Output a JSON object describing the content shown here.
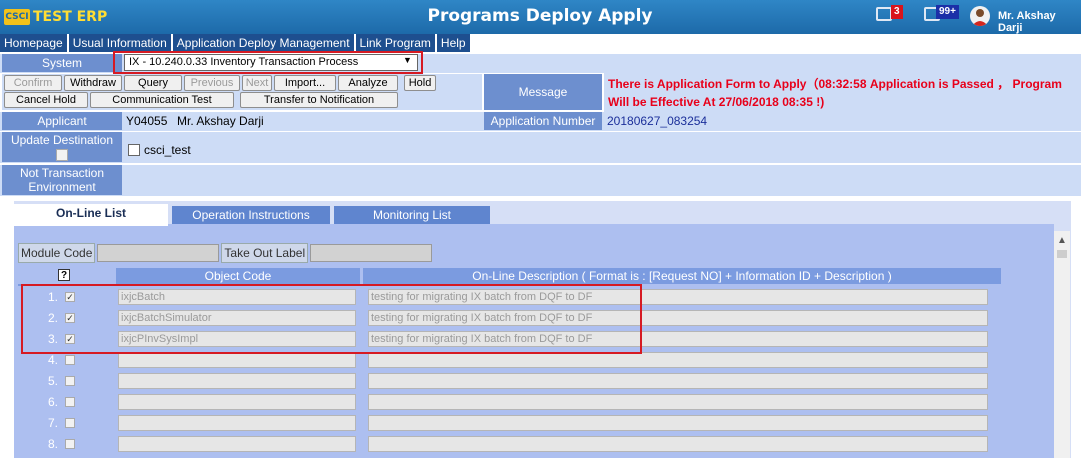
{
  "app": {
    "logo_mark": "CSCI",
    "logo_text": "TEST ERP",
    "page_title": "Programs Deploy Apply"
  },
  "header": {
    "notification_count": "3",
    "mail_count": "99+",
    "user_name": "Mr. Akshay Darji"
  },
  "menu": [
    "Homepage",
    "Usual Information",
    "Application Deploy Management",
    "Link Program",
    "Help"
  ],
  "form": {
    "system_label": "System",
    "system_value": "IX - 10.240.0.33 Inventory Transaction Process",
    "buttons_row1": [
      {
        "label": "Confirm",
        "disabled": true
      },
      {
        "label": "Withdraw",
        "disabled": false
      },
      {
        "label": "Query",
        "disabled": false
      },
      {
        "label": "Previous",
        "disabled": true
      },
      {
        "label": "Next",
        "disabled": true
      },
      {
        "label": "Import...",
        "disabled": false
      },
      {
        "label": "Analyze",
        "disabled": false
      },
      {
        "label": "Hold",
        "disabled": false
      }
    ],
    "buttons_row2": [
      "Cancel Hold",
      "Communication Test",
      "Transfer to Notification"
    ],
    "message_label": "Message",
    "message_text": "There is Application Form to Apply（08:32:58 Application is Passed ， Program Will be Effective At 27/06/2018 08:35 !)",
    "applicant_label": "Applicant",
    "applicant_id": "Y04055",
    "applicant_name": "Mr. Akshay Darji",
    "application_number_label": "Application Number",
    "application_number": "20180627_083254",
    "update_destination_label": "Update Destination",
    "destination_option": "csci_test",
    "not_transaction_label": "Not Transaction Environment"
  },
  "tabs": [
    "On-Line List",
    "Operation Instructions",
    "Monitoring List"
  ],
  "filters": {
    "module_code_label": "Module Code",
    "take_out_label": "Take Out Label"
  },
  "table": {
    "help_mark": "?",
    "columns": [
      "Object Code",
      "On-Line Description ( Format is : [Request NO] + Information ID + Description )"
    ],
    "rows": [
      {
        "num": "1.",
        "checked": true,
        "code": "ixjcBatch",
        "desc": "testing for migrating IX batch from DQF to DF"
      },
      {
        "num": "2.",
        "checked": true,
        "code": "ixjcBatchSimulator",
        "desc": "testing for migrating IX batch from DQF to DF"
      },
      {
        "num": "3.",
        "checked": true,
        "code": "ixjcPInvSysImpl",
        "desc": "testing for migrating IX batch from DQF to DF"
      },
      {
        "num": "4.",
        "checked": false,
        "code": "",
        "desc": ""
      },
      {
        "num": "5.",
        "checked": false,
        "code": "",
        "desc": ""
      },
      {
        "num": "6.",
        "checked": false,
        "code": "",
        "desc": ""
      },
      {
        "num": "7.",
        "checked": false,
        "code": "",
        "desc": ""
      },
      {
        "num": "8.",
        "checked": false,
        "code": "",
        "desc": ""
      }
    ]
  },
  "colors": {
    "header_blue": "#1d6aa9",
    "menu_navy": "#1e4f8f",
    "label_blue": "#6d8fcf",
    "value_blue": "#cddcf6",
    "message_red": "#e8001a",
    "highlight_red": "#d61a23"
  }
}
